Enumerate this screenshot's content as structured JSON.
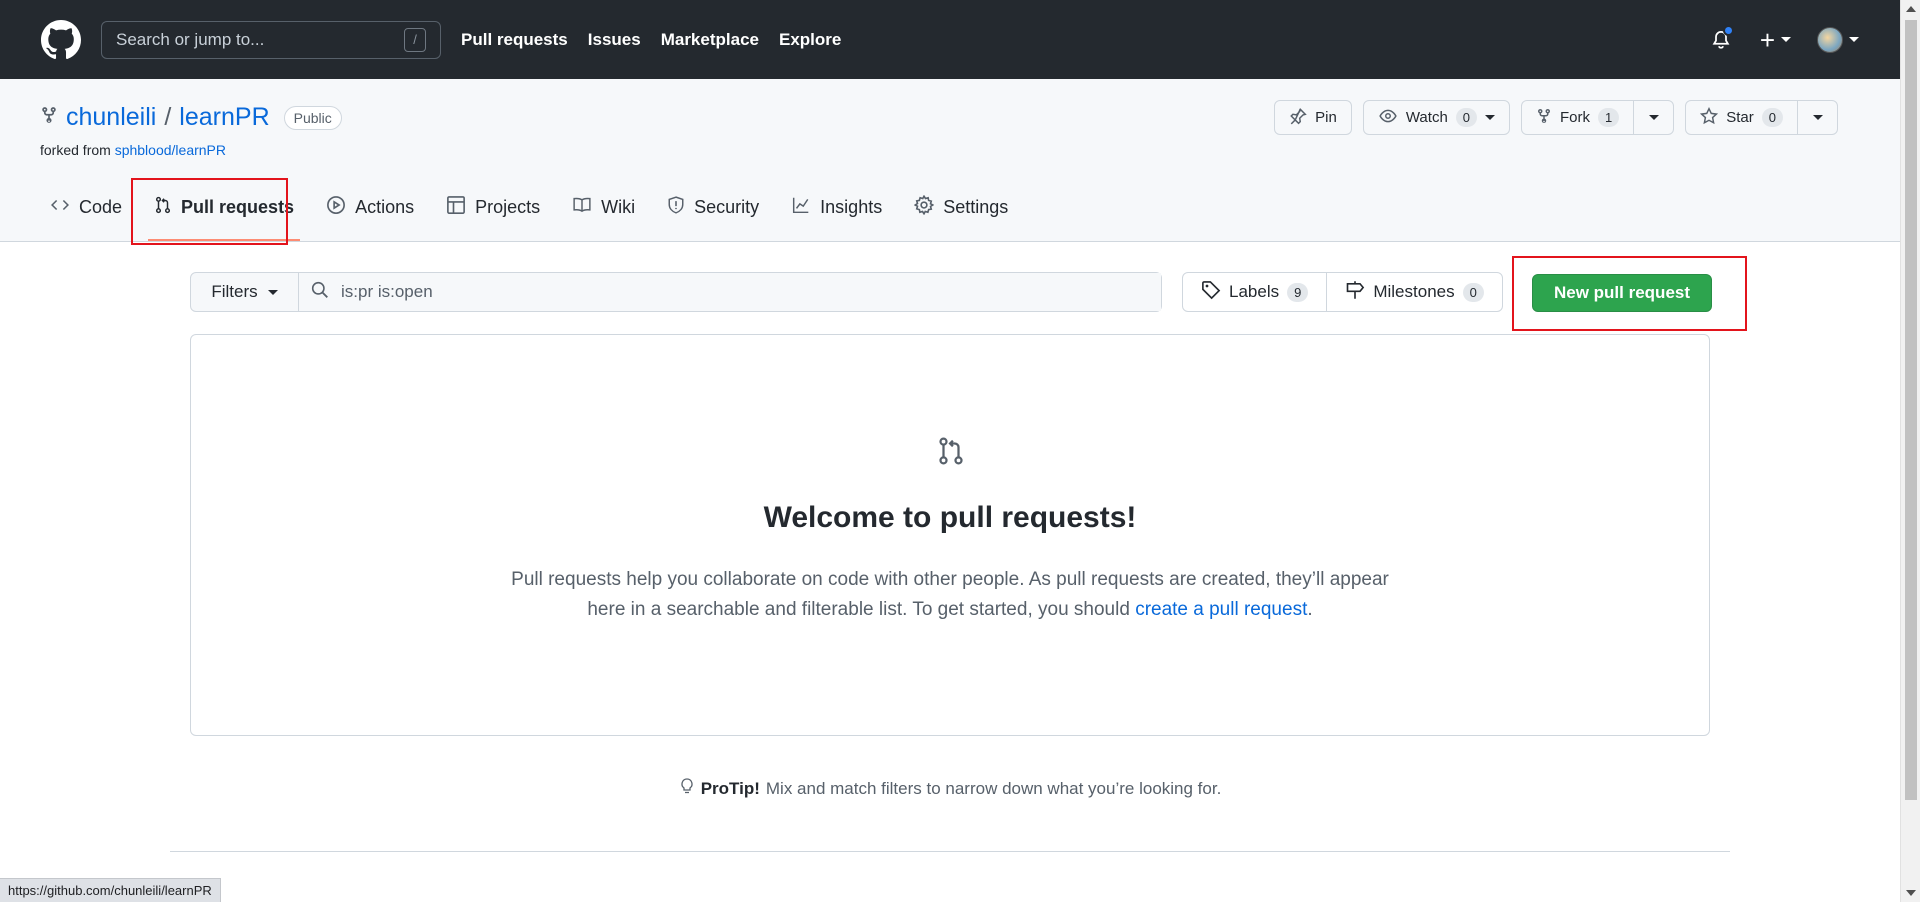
{
  "header": {
    "search_placeholder": "Search or jump to...",
    "search_shortcut": "/",
    "nav": [
      "Pull requests",
      "Issues",
      "Marketplace",
      "Explore"
    ]
  },
  "repo": {
    "owner": "chunleili",
    "separator": "/",
    "name": "learnPR",
    "visibility": "Public",
    "forked_prefix": "forked from",
    "forked_source": "sphblood/learnPR",
    "actions": {
      "pin": "Pin",
      "watch": "Watch",
      "watch_count": "0",
      "fork": "Fork",
      "fork_count": "1",
      "star": "Star",
      "star_count": "0"
    },
    "tabs": [
      "Code",
      "Pull requests",
      "Actions",
      "Projects",
      "Wiki",
      "Security",
      "Insights",
      "Settings"
    ],
    "selected_tab": "Pull requests"
  },
  "toolbar": {
    "filters": "Filters",
    "query": "is:pr is:open",
    "labels": "Labels",
    "labels_count": "9",
    "milestones": "Milestones",
    "milestones_count": "0",
    "new_pr": "New pull request"
  },
  "blankslate": {
    "title": "Welcome to pull requests!",
    "text": "Pull requests help you collaborate on code with other people. As pull requests are created, they’ll appear here in a searchable and filterable list. To get started, you should",
    "link": "create a pull request",
    "end": "."
  },
  "protip": {
    "label": "ProTip!",
    "text": "Mix and match filters to narrow down what you’re looking for."
  },
  "statusbar": {
    "url": "https://github.com/chunleili/learnPR"
  },
  "colors": {
    "header_bg": "#24292f",
    "link": "#0969da",
    "primary_button": "#2da44e",
    "highlight_box": "#e3141c",
    "tab_underline": "#fd8c73"
  }
}
